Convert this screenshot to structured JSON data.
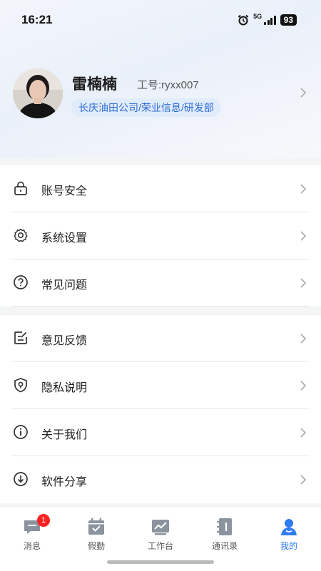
{
  "status_bar": {
    "time": "16:21",
    "network": "5G",
    "battery": "93"
  },
  "profile": {
    "name": "雷楠楠",
    "job_id": "工号:ryxx007",
    "department": "长庆油田公司/荣业信息/研发部"
  },
  "menu_group_1": [
    {
      "label": "账号安全",
      "icon": "lock-icon"
    },
    {
      "label": "系统设置",
      "icon": "gear-icon"
    },
    {
      "label": "常见问题",
      "icon": "question-icon"
    }
  ],
  "menu_group_2": [
    {
      "label": "意见反馈",
      "icon": "feedback-edit-icon"
    },
    {
      "label": "隐私说明",
      "icon": "privacy-shield-icon"
    },
    {
      "label": "关于我们",
      "icon": "info-icon"
    },
    {
      "label": "软件分享",
      "icon": "download-share-icon"
    }
  ],
  "tabbar": [
    {
      "label": "消息",
      "icon": "message-icon",
      "badge": "1"
    },
    {
      "label": "假勤",
      "icon": "calendar-icon"
    },
    {
      "label": "工作台",
      "icon": "workbench-chart-icon"
    },
    {
      "label": "通讯录",
      "icon": "contacts-book-icon"
    },
    {
      "label": "我的",
      "icon": "person-icon",
      "active": true
    }
  ],
  "colors": {
    "accent": "#2f7bf2",
    "badge": "#ff2222",
    "dept_tag_bg": "#e1ecfb"
  }
}
